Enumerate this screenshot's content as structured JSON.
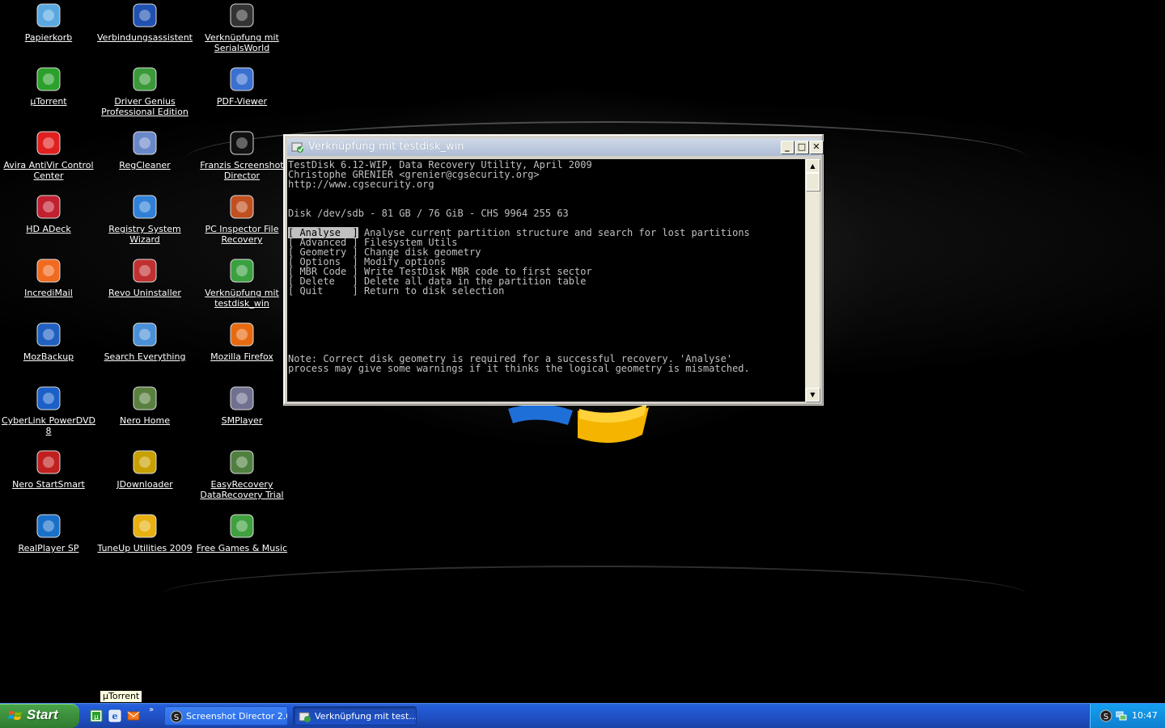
{
  "desktop": {
    "icons": [
      {
        "label": "Papierkorb",
        "icon": "recycle-bin-icon"
      },
      {
        "label": "Verbindungsassistent",
        "icon": "connection-wizard-icon"
      },
      {
        "label": "Verknüpfung mit SerialsWorld",
        "icon": "serialsworld-icon"
      },
      {
        "label": "µTorrent",
        "icon": "utorrent-icon"
      },
      {
        "label": "Driver Genius Professional Edition",
        "icon": "driver-genius-icon"
      },
      {
        "label": "PDF-Viewer",
        "icon": "pdf-viewer-icon"
      },
      {
        "label": "Avira AntiVir Control Center",
        "icon": "avira-icon"
      },
      {
        "label": "RegCleaner",
        "icon": "regcleaner-icon"
      },
      {
        "label": "Franzis Screenshot Director",
        "icon": "screenshot-director-icon"
      },
      {
        "label": "HD ADeck",
        "icon": "hd-adeck-icon"
      },
      {
        "label": "Registry System Wizard",
        "icon": "registry-wizard-icon"
      },
      {
        "label": "PC Inspector File Recovery",
        "icon": "pc-inspector-icon"
      },
      {
        "label": "IncrediMail",
        "icon": "incredimail-icon"
      },
      {
        "label": "Revo Uninstaller",
        "icon": "revo-uninstaller-icon"
      },
      {
        "label": "Verknüpfung mit testdisk_win",
        "icon": "testdisk-shortcut-icon"
      },
      {
        "label": "MozBackup",
        "icon": "mozbackup-icon"
      },
      {
        "label": "Search Everything",
        "icon": "search-everything-icon"
      },
      {
        "label": "Mozilla Firefox",
        "icon": "firefox-icon"
      },
      {
        "label": "CyberLink PowerDVD 8",
        "icon": "powerdvd-icon"
      },
      {
        "label": "Nero Home",
        "icon": "nero-home-icon"
      },
      {
        "label": "SMPlayer",
        "icon": "smplayer-icon"
      },
      {
        "label": "Nero StartSmart",
        "icon": "nero-startsmart-icon"
      },
      {
        "label": "JDownloader",
        "icon": "jdownloader-icon"
      },
      {
        "label": "EasyRecovery DataRecovery Trial",
        "icon": "easyrecovery-icon"
      },
      {
        "label": "RealPlayer SP",
        "icon": "realplayer-icon"
      },
      {
        "label": "TuneUp Utilities 2009",
        "icon": "tuneup-icon"
      },
      {
        "label": "Free Games & Music",
        "icon": "free-games-icon"
      }
    ],
    "tooltip": "µTorrent"
  },
  "console": {
    "title": "Verknüpfung mit testdisk_win",
    "minimize": "_",
    "maximize": "□",
    "close": "✕",
    "header_lines": [
      "TestDisk 6.12-WIP, Data Recovery Utility, April 2009",
      "Christophe GRENIER <grenier@cgsecurity.org>",
      "http://www.cgsecurity.org"
    ],
    "disk_line": "Disk /dev/sdb - 81 GB / 76 GiB - CHS 9964 255 63",
    "menu": [
      {
        "key": "[ Analyse  ]",
        "desc": "Analyse current partition structure and search for lost partitions",
        "selected": true
      },
      {
        "key": "[ Advanced ]",
        "desc": "Filesystem Utils",
        "selected": false
      },
      {
        "key": "[ Geometry ]",
        "desc": "Change disk geometry",
        "selected": false
      },
      {
        "key": "[ Options  ]",
        "desc": "Modify options",
        "selected": false
      },
      {
        "key": "[ MBR Code ]",
        "desc": "Write TestDisk MBR code to first sector",
        "selected": false
      },
      {
        "key": "[ Delete   ]",
        "desc": "Delete all data in the partition table",
        "selected": false
      },
      {
        "key": "[ Quit     ]",
        "desc": "Return to disk selection",
        "selected": false
      }
    ],
    "note_lines": [
      "Note: Correct disk geometry is required for a successful recovery. 'Analyse'",
      "process may give some warnings if it thinks the logical geometry is mismatched."
    ]
  },
  "taskbar": {
    "start_label": "Start",
    "quick_launch": [
      "utorrent-icon",
      "ie-icon",
      "incredimail-icon"
    ],
    "chevron": "»",
    "tasks": [
      {
        "label": "Screenshot Director 2.0",
        "icon": "screenshot-director-icon",
        "active": false
      },
      {
        "label": "Verknüpfung mit test...",
        "icon": "testdisk-shortcut-icon",
        "active": true
      }
    ],
    "clock": "10:47"
  }
}
